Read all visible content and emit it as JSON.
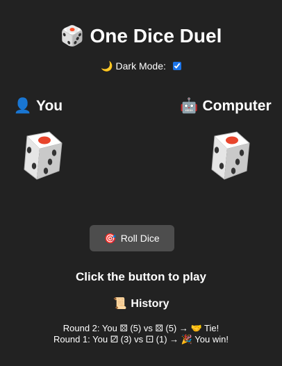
{
  "header": {
    "icon": "🎲",
    "title": "One Dice Duel"
  },
  "dark_mode": {
    "icon": "🌙",
    "label": "Dark Mode:",
    "checked": true
  },
  "players": {
    "you": {
      "icon": "👤",
      "name": "You"
    },
    "computer": {
      "icon": "🤖",
      "name": "Computer"
    }
  },
  "roll_button": {
    "icon": "🎯",
    "label": "Roll Dice"
  },
  "status": "Click the button to play",
  "history": {
    "icon": "📜",
    "title": "History",
    "entries": [
      "Round 2: You ⚄ (5) vs ⚄ (5) → 🤝 Tie!",
      "Round 1: You ⚂ (3) vs ⚀ (1) → 🎉 You win!"
    ]
  },
  "colors": {
    "background": "#222222",
    "button": "#4d4d4d",
    "die_pip_red": "#e8452c"
  }
}
